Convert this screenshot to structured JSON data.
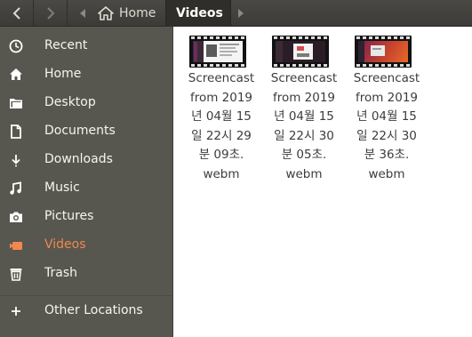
{
  "header": {
    "back_icon": "chevron-left-icon",
    "forward_icon": "chevron-right-icon",
    "breadcrumbs": [
      {
        "label": "Home",
        "icon": "home-icon"
      },
      {
        "label": "Videos"
      }
    ]
  },
  "sidebar": {
    "items": [
      {
        "label": "Recent",
        "icon": "clock-icon"
      },
      {
        "label": "Home",
        "icon": "home-icon"
      },
      {
        "label": "Desktop",
        "icon": "folder-icon"
      },
      {
        "label": "Documents",
        "icon": "document-icon"
      },
      {
        "label": "Downloads",
        "icon": "download-icon"
      },
      {
        "label": "Music",
        "icon": "music-icon"
      },
      {
        "label": "Pictures",
        "icon": "camera-icon"
      },
      {
        "label": "Videos",
        "icon": "video-icon",
        "active": true
      },
      {
        "label": "Trash",
        "icon": "trash-icon"
      },
      {
        "label": "Other Locations",
        "icon": "plus-icon"
      }
    ]
  },
  "files": [
    {
      "name": "Screencast\nfrom 2019\n년 04월 15\n일 22시 29\n분 09초.\nwebm"
    },
    {
      "name": "Screencast\nfrom 2019\n년 04월 15\n일 22시 30\n분 05초.\nwebm"
    },
    {
      "name": "Screencast\nfrom 2019\n년 04월 15\n일 22시 30\n분 36초.\nwebm"
    }
  ],
  "colors": {
    "accent": "#f08850",
    "sidebar_bg": "#58574f",
    "header_bg": "#3c3b37"
  }
}
